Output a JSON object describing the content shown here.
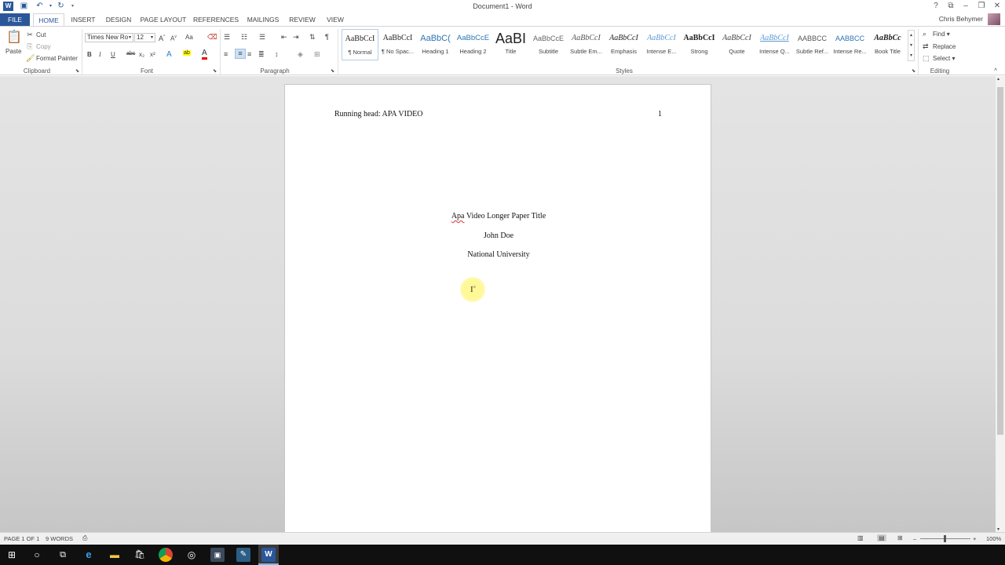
{
  "window": {
    "title": "Document1 - Word",
    "user": "Chris Behymer"
  },
  "quick_access": {
    "icons": [
      "word-logo-icon",
      "save-icon",
      "undo-icon",
      "redo-icon",
      "customize-qat-icon"
    ]
  },
  "window_controls": [
    "help-icon",
    "ribbon-display-icon",
    "minimize-icon",
    "restore-icon",
    "close-icon"
  ],
  "tabs": {
    "file": "FILE",
    "home": "HOME",
    "insert": "INSERT",
    "design": "DESIGN",
    "page_layout": "PAGE LAYOUT",
    "references": "REFERENCES",
    "mailings": "MAILINGS",
    "review": "REVIEW",
    "view": "VIEW"
  },
  "clipboard": {
    "label": "Clipboard",
    "paste": "Paste",
    "cut": "Cut",
    "copy": "Copy",
    "format_painter": "Format Painter"
  },
  "font": {
    "label": "Font",
    "name": "Times New Ro",
    "size": "12",
    "change_case": "Aa",
    "bold": "B",
    "italic": "I",
    "underline": "U",
    "strikethrough": "abc",
    "subscript": "x₂",
    "superscript": "x²",
    "text_effects": "A",
    "highlight": "ab",
    "font_color": "A"
  },
  "paragraph": {
    "label": "Paragraph"
  },
  "styles": {
    "label": "Styles",
    "items": [
      {
        "preview": "AaBbCcI",
        "name": "¶ Normal"
      },
      {
        "preview": "AaBbCcI",
        "name": "¶ No Spac..."
      },
      {
        "preview": "AaBbC(",
        "name": "Heading 1"
      },
      {
        "preview": "AaBbCcE",
        "name": "Heading 2"
      },
      {
        "preview": "AaBI",
        "name": "Title"
      },
      {
        "preview": "AaBbCcE",
        "name": "Subtitle"
      },
      {
        "preview": "AaBbCcI",
        "name": "Subtle Em..."
      },
      {
        "preview": "AaBbCcI",
        "name": "Emphasis"
      },
      {
        "preview": "AaBbCcI",
        "name": "Intense E..."
      },
      {
        "preview": "AaBbCcI",
        "name": "Strong"
      },
      {
        "preview": "AaBbCcI",
        "name": "Quote"
      },
      {
        "preview": "AaBbCcI",
        "name": "Intense Q..."
      },
      {
        "preview": "AABBCC",
        "name": "Subtle Ref..."
      },
      {
        "preview": "AABBCC",
        "name": "Intense Re..."
      },
      {
        "preview": "AaBbCc",
        "name": "Book Title"
      }
    ]
  },
  "editing": {
    "label": "Editing",
    "find": "Find",
    "replace": "Replace",
    "select": "Select"
  },
  "document": {
    "running_head": "Running head: APA VIDEO",
    "page_number": "1",
    "title_first_word": "Apa",
    "title_rest": " Video Longer Paper Title",
    "author": "John Doe",
    "institution": "National University"
  },
  "status": {
    "page": "PAGE 1 OF 1",
    "words": "9 WORDS",
    "zoom": "100%"
  },
  "colors": {
    "word_blue": "#2b579a",
    "taskbar": "#101010",
    "cursor_highlight": "#fff38c"
  }
}
